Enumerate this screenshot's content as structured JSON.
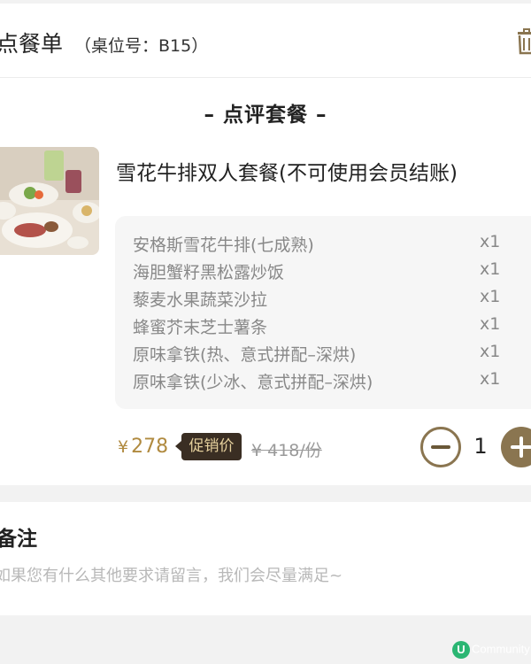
{
  "header": {
    "title": "点餐单",
    "table_label": "（桌位号：B15）",
    "clear_icon": "trash-icon"
  },
  "section": {
    "title": "– 点评套餐 –"
  },
  "product": {
    "name": "雪花牛排双人套餐(不可使用会员结账)",
    "items": [
      {
        "name": "安格斯雪花牛排(七成熟)",
        "qty": "x1"
      },
      {
        "name": "海胆蟹籽黑松露炒饭",
        "qty": "x1"
      },
      {
        "name": "藜麦水果蔬菜沙拉",
        "qty": "x1"
      },
      {
        "name": "蜂蜜芥末芝士薯条",
        "qty": "x1"
      },
      {
        "name": "原味拿铁(热、意式拼配–深烘)",
        "qty": "x1"
      },
      {
        "name": "原味拿铁(少冰、意式拼配–深烘)",
        "qty": "x1"
      }
    ],
    "currency": "¥",
    "price": "278",
    "promo_label": "促销价",
    "original_price": "¥ 418/份",
    "quantity": "1"
  },
  "notes": {
    "title": "备注",
    "placeholder": "如果您有什么其他要求请留言，我们会尽量满足~"
  },
  "watermark": {
    "logo": "U",
    "text": "Community"
  },
  "colors": {
    "accent": "#8a7550",
    "price": "#b08a3f",
    "promo_bg": "#3a2e23",
    "promo_text": "#e4cf9c"
  }
}
